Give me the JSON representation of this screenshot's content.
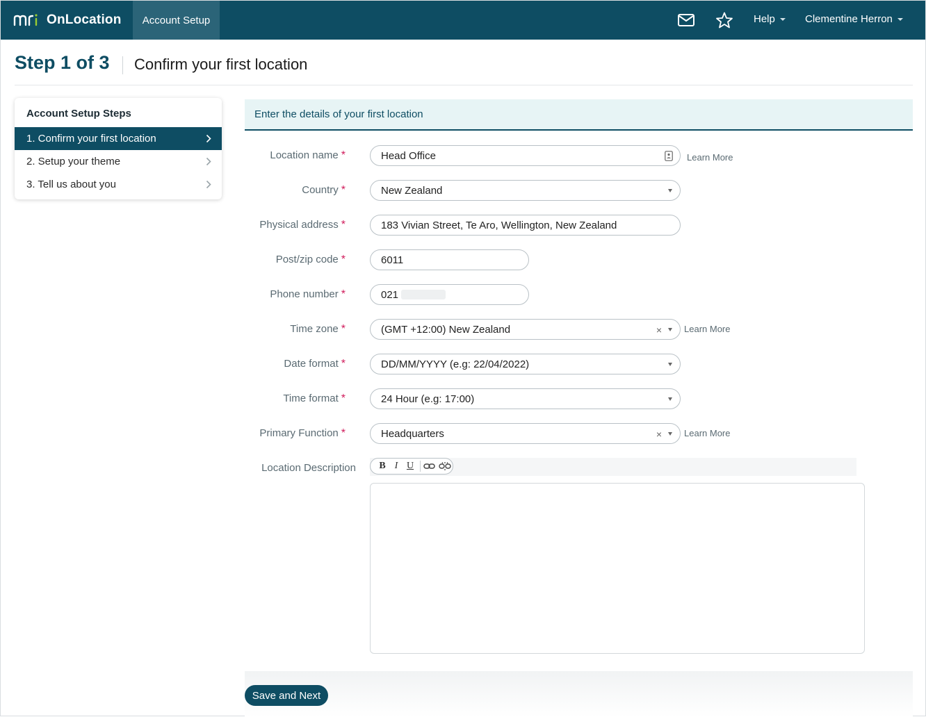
{
  "app": {
    "brand": "OnLocation",
    "active_tab": "Account Setup",
    "help_label": "Help",
    "user_name": "Clementine Herron",
    "colors": {
      "primary": "#0e4d63",
      "required": "#d01c5b",
      "panel_bg": "#e7f4f5"
    }
  },
  "page": {
    "step": "Step 1 of 3",
    "subtitle": "Confirm your first location"
  },
  "steps": {
    "title": "Account Setup Steps",
    "items": [
      {
        "label": "1. Confirm your first location",
        "active": true
      },
      {
        "label": "2. Setup your theme",
        "active": false
      },
      {
        "label": "3. Tell us about you",
        "active": false
      }
    ]
  },
  "form": {
    "heading": "Enter the details of your first location",
    "learn_more": "Learn More",
    "location_name": {
      "label": "Location name",
      "value": "Head Office"
    },
    "country": {
      "label": "Country",
      "value": "New Zealand"
    },
    "address": {
      "label": "Physical address",
      "value": "183 Vivian Street, Te Aro, Wellington, New Zealand"
    },
    "postcode": {
      "label": "Post/zip code",
      "value": "6011"
    },
    "phone": {
      "label": "Phone number",
      "value": "021"
    },
    "timezone": {
      "label": "Time zone",
      "value": "(GMT +12:00) New Zealand"
    },
    "date_format": {
      "label": "Date format",
      "value": "DD/MM/YYYY (e.g: 22/04/2022)"
    },
    "time_format": {
      "label": "Time format",
      "value": "24 Hour (e.g: 17:00)"
    },
    "primary_function": {
      "label": "Primary Function",
      "value": "Headquarters"
    },
    "description": {
      "label": "Location Description"
    },
    "toolbar": {
      "bold": "B",
      "italic": "I",
      "underline": "U"
    },
    "save_label": "Save and Next"
  }
}
